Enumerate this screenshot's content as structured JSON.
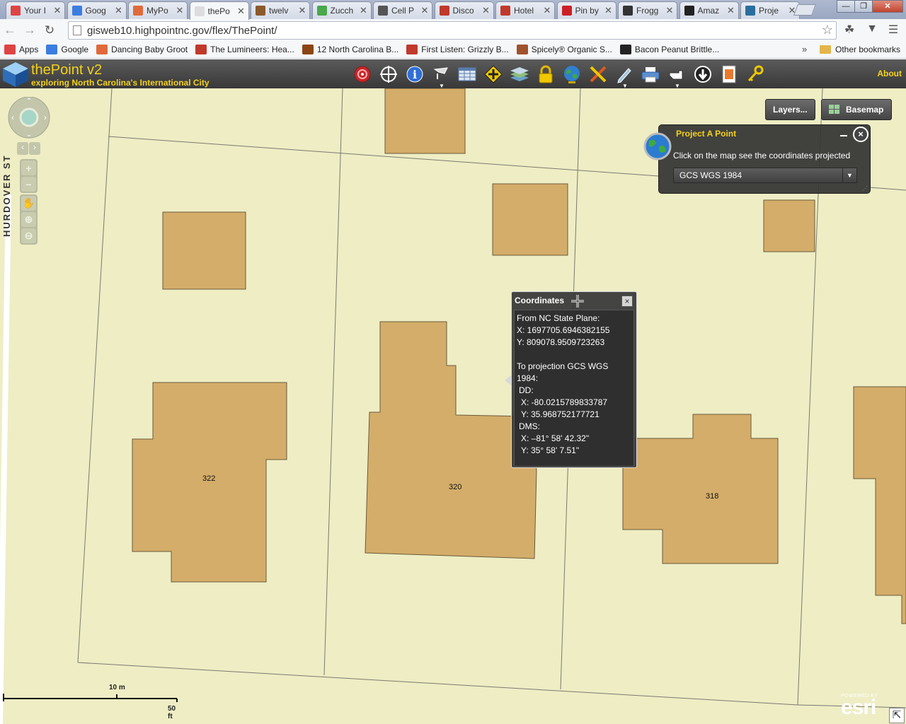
{
  "browser": {
    "tabs": [
      {
        "label": "Your I",
        "color": "#d44"
      },
      {
        "label": "Goog",
        "color": "#3b7de0"
      },
      {
        "label": "MyPo",
        "color": "#e06a3b"
      },
      {
        "label": "thePo",
        "color": "#ddd",
        "active": true
      },
      {
        "label": "twelv",
        "color": "#8b5a2b"
      },
      {
        "label": "Zucch",
        "color": "#4aa84a"
      },
      {
        "label": "Cell P",
        "color": "#555"
      },
      {
        "label": "Disco",
        "color": "#c0392b"
      },
      {
        "label": "Hotel",
        "color": "#c0392b"
      },
      {
        "label": "Pin by",
        "color": "#cb2027"
      },
      {
        "label": "Frogg",
        "color": "#333"
      },
      {
        "label": "Amaz",
        "color": "#222"
      },
      {
        "label": "Proje",
        "color": "#2a6e9e"
      }
    ],
    "close_glyph": "✕",
    "window_buttons": {
      "minimize": "—",
      "maximize": "❐",
      "close": "✕"
    },
    "url": "gisweb10.highpointnc.gov/flex/ThePoint/",
    "bookmarks": [
      {
        "label": "Apps",
        "color": "#d44"
      },
      {
        "label": "Google",
        "color": "#3b7de0"
      },
      {
        "label": "Dancing Baby Groot",
        "color": "#e06a3b"
      },
      {
        "label": "The Lumineers: Hea...",
        "color": "#c0392b"
      },
      {
        "label": "12 North Carolina B...",
        "color": "#8b4513"
      },
      {
        "label": "First Listen: Grizzly B...",
        "color": "#c0392b"
      },
      {
        "label": "Spicely® Organic S...",
        "color": "#a0522d"
      },
      {
        "label": "Bacon Peanut Brittle...",
        "color": "#222"
      }
    ],
    "bookmarks_more": "»",
    "other_bookmarks": "Other bookmarks"
  },
  "app": {
    "title": "thePoint v2",
    "subtitle": "exploring North Carolina's International City",
    "about": "About",
    "accent": "#f4d21c"
  },
  "tools": [
    "target-icon",
    "crosshair-icon",
    "info-icon",
    "measure-dropdown-icon",
    "table-icon",
    "pan-to-icon",
    "layers-stack-icon",
    "lock-icon",
    "globe-icon",
    "draw-icon",
    "pen-dropdown-icon",
    "print-icon",
    "hand-pointer-dropdown-icon",
    "download-icon",
    "document-icon",
    "key-icon"
  ],
  "map": {
    "layers_button": "Layers...",
    "basemap_button": "Basemap",
    "street_label": "HURDOVER ST",
    "lot_labels": [
      "322",
      "320",
      "318"
    ],
    "scale_metric": "10 m",
    "scale_imperial": "50 ft",
    "esri_powered": "POWERED BY",
    "esri": "esri",
    "land_color": "#eeedc4",
    "building_color": "#d4ad6a"
  },
  "project_panel": {
    "title": "Project A Point",
    "instruction": "Click on the map see the coordinates projected",
    "selected_projection": "GCS WGS 1984"
  },
  "coordinates_popup": {
    "title": "Coordinates",
    "from_label": "From NC State Plane:",
    "x_state": "X: 1697705.6946382155",
    "y_state": "Y: 809078.9509723263",
    "to_label": "To projection GCS WGS 1984:",
    "dd_label": "DD:",
    "dd_x": "X:  -80.0215789833787",
    "dd_y": "Y:  35.968752177721",
    "dms_label": "DMS:",
    "dms_x": "X:  –81° 58' 42.32\"",
    "dms_y": "Y:  35° 58' 7.51\""
  }
}
